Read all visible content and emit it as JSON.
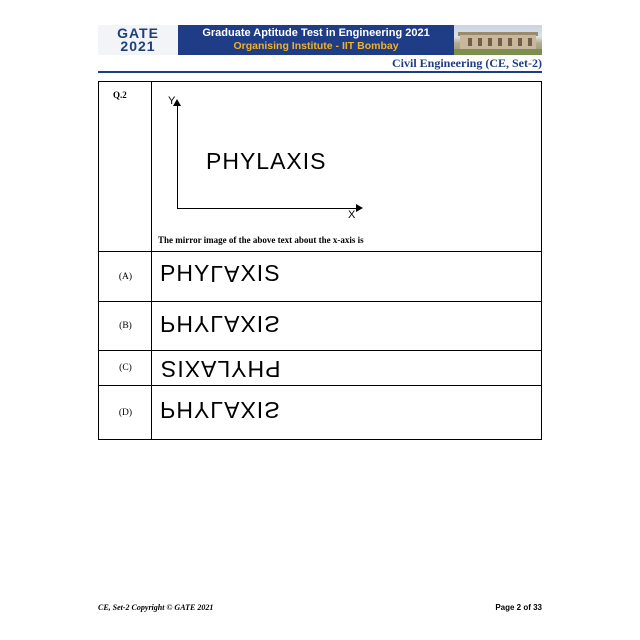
{
  "header": {
    "logo_text": "GATE",
    "logo_year": "2021",
    "title_line1": "Graduate Aptitude Test in Engineering 2021",
    "title_line2": "Organising Institute - IIT Bombay",
    "photo_icon": "campus-building-photo",
    "discipline": "Civil Engineering (CE, Set-2)"
  },
  "question": {
    "number": "Q.2",
    "figure": {
      "y_label": "Y",
      "x_label": "X",
      "word": "PHYLAXIS"
    },
    "stem": "The mirror image of the above text about the x-axis is"
  },
  "options": [
    {
      "label": "(A)",
      "text": "PHYLAXIS",
      "transform": "upside-down letters"
    },
    {
      "label": "(B)",
      "text": "PHYLAXIS",
      "transform": "vertical flip"
    },
    {
      "label": "(C)",
      "text": "PHYLAXIS",
      "transform": "rotated 180°"
    },
    {
      "label": "(D)",
      "text": "PHYLAXIS",
      "transform": "vertical flip"
    }
  ],
  "footer": {
    "left": "CE, Set-2 Copyright © GATE 2021",
    "right": "Page 2 of 33"
  },
  "colors": {
    "brand_blue": "#1f3d86",
    "accent_gold": "#f2b224"
  }
}
